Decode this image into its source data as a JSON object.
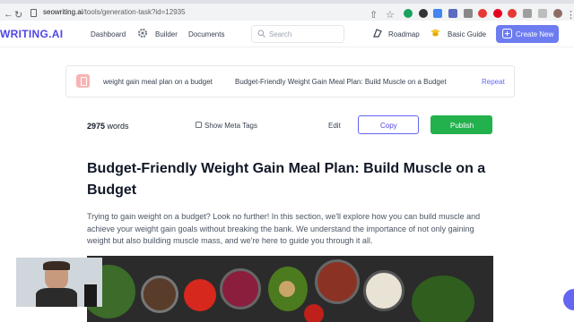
{
  "browser": {
    "url_domain": "seowriting.ai",
    "url_path": "/tools/generation-task?id=12935"
  },
  "nav": {
    "logo": "WRITING.AI",
    "dashboard": "Dashboard",
    "builder": "Builder",
    "documents": "Documents",
    "search_placeholder": "Search",
    "roadmap": "Roadmap",
    "basic_guide": "Basic Guide",
    "create_new": "Create New"
  },
  "task": {
    "keyword": "weight gain meal plan on a budget",
    "title": "Budget-Friendly Weight Gain Meal Plan: Build Muscle on a Budget",
    "repeat": "Repeat"
  },
  "toolbar": {
    "word_count": "2975",
    "words_label": "words",
    "show_meta": "Show Meta Tags",
    "edit": "Edit",
    "copy": "Copy",
    "publish": "Publish"
  },
  "article": {
    "heading": "Budget-Friendly Weight Gain Meal Plan: Build Muscle on a Budget",
    "intro": "Trying to gain weight on a budget? Look no further! In this section, we'll explore how you can build muscle and achieve your weight gain goals without breaking the bank. We understand the importance of not only gaining weight but also building muscle mass, and we're here to guide you through it all."
  },
  "colors": {
    "accent": "#6366f1",
    "publish": "#22b14c",
    "create": "#6d7cf0"
  }
}
